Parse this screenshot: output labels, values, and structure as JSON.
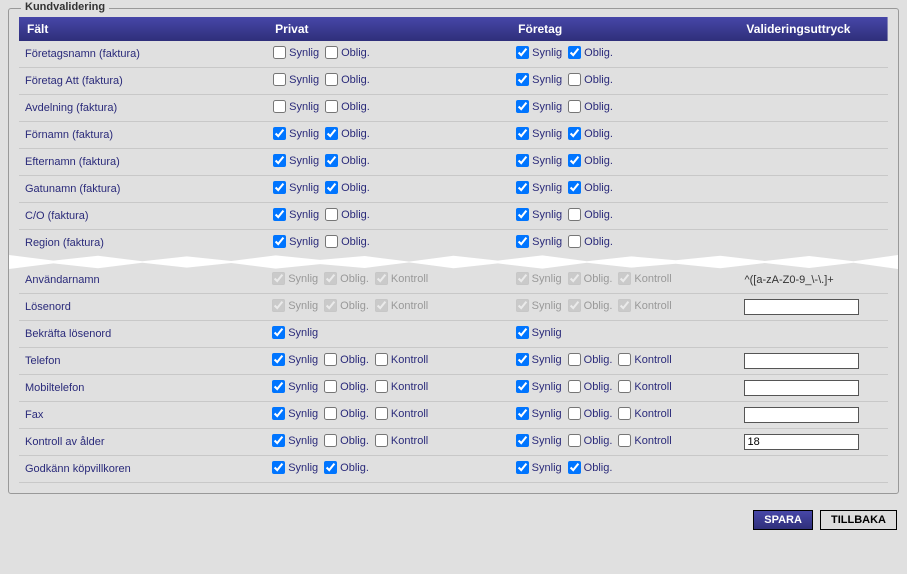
{
  "fieldset_title": "Kundvalidering",
  "headers": {
    "field": "Fält",
    "private": "Privat",
    "company": "Företag",
    "validation": "Valideringsuttryck"
  },
  "labels": {
    "synlig": "Synlig",
    "oblig": "Oblig.",
    "kontroll": "Kontroll"
  },
  "buttons": {
    "save": "SPARA",
    "back": "TILLBAKA"
  },
  "rows_top": [
    {
      "field": "Företagsnamn (faktura)",
      "p_synlig": false,
      "p_oblig": false,
      "c_synlig": true,
      "c_oblig": true
    },
    {
      "field": "Företag Att (faktura)",
      "p_synlig": false,
      "p_oblig": false,
      "c_synlig": true,
      "c_oblig": false
    },
    {
      "field": "Avdelning (faktura)",
      "p_synlig": false,
      "p_oblig": false,
      "c_synlig": true,
      "c_oblig": false
    },
    {
      "field": "Förnamn (faktura)",
      "p_synlig": true,
      "p_oblig": true,
      "c_synlig": true,
      "c_oblig": true
    },
    {
      "field": "Efternamn (faktura)",
      "p_synlig": true,
      "p_oblig": true,
      "c_synlig": true,
      "c_oblig": true
    },
    {
      "field": "Gatunamn (faktura)",
      "p_synlig": true,
      "p_oblig": true,
      "c_synlig": true,
      "c_oblig": true
    },
    {
      "field": "C/O (faktura)",
      "p_synlig": true,
      "p_oblig": false,
      "c_synlig": true,
      "c_oblig": false
    },
    {
      "field": "Region (faktura)",
      "p_synlig": true,
      "p_oblig": false,
      "c_synlig": true,
      "c_oblig": false
    }
  ],
  "rows_bottom": [
    {
      "field": "Användarnamn",
      "disabled": true,
      "has_kontroll": true,
      "p_synlig": true,
      "p_oblig": true,
      "p_kontroll": true,
      "c_synlig": true,
      "c_oblig": true,
      "c_kontroll": true,
      "val_text": "^([a-zA-Z0-9_\\-\\.]+",
      "val_is_input": false
    },
    {
      "field": "Lösenord",
      "disabled": true,
      "has_kontroll": true,
      "p_synlig": true,
      "p_oblig": true,
      "p_kontroll": true,
      "c_synlig": true,
      "c_oblig": true,
      "c_kontroll": true,
      "val_text": "",
      "val_is_input": true
    },
    {
      "field": "Bekräfta lösenord",
      "disabled": false,
      "has_kontroll": false,
      "only_synlig": true,
      "p_synlig": true,
      "c_synlig": true
    },
    {
      "field": "Telefon",
      "disabled": false,
      "has_kontroll": true,
      "p_synlig": true,
      "p_oblig": false,
      "p_kontroll": false,
      "c_synlig": true,
      "c_oblig": false,
      "c_kontroll": false,
      "val_text": "",
      "val_is_input": true
    },
    {
      "field": "Mobiltelefon",
      "disabled": false,
      "has_kontroll": true,
      "p_synlig": true,
      "p_oblig": false,
      "p_kontroll": false,
      "c_synlig": true,
      "c_oblig": false,
      "c_kontroll": false,
      "val_text": "",
      "val_is_input": true
    },
    {
      "field": "Fax",
      "disabled": false,
      "has_kontroll": true,
      "p_synlig": true,
      "p_oblig": false,
      "p_kontroll": false,
      "c_synlig": true,
      "c_oblig": false,
      "c_kontroll": false,
      "val_text": "",
      "val_is_input": true
    },
    {
      "field": "Kontroll av ålder",
      "disabled": false,
      "has_kontroll": true,
      "p_synlig": true,
      "p_oblig": false,
      "p_kontroll": false,
      "c_synlig": true,
      "c_oblig": false,
      "c_kontroll": false,
      "val_text": "18",
      "val_is_input": true
    },
    {
      "field": "Godkänn köpvillkoren",
      "disabled": false,
      "has_kontroll": false,
      "p_synlig": true,
      "p_oblig": true,
      "c_synlig": true,
      "c_oblig": true
    }
  ]
}
